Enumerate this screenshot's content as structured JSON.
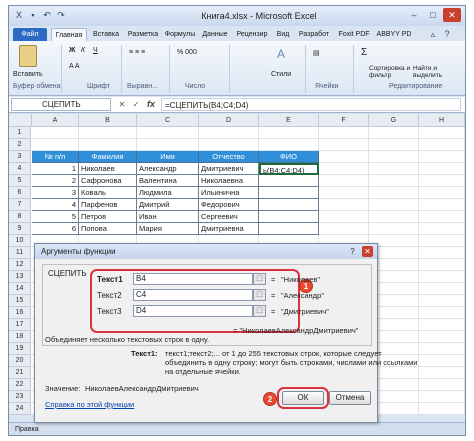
{
  "window": {
    "title": "Книга4.xlsx - Microsoft Excel"
  },
  "tabs": [
    "Файл",
    "Главная",
    "Вставка",
    "Разметка",
    "Формулы",
    "Данные",
    "Рецензир",
    "Вид",
    "Разработ",
    "Foxit PDF",
    "ABBYY PD"
  ],
  "ribbon": {
    "paste": "Вставить",
    "clipboard": "Буфер обмена",
    "font": "Шрифт",
    "align": "Выравн...",
    "number": "Число",
    "styles": "Стили",
    "cells": "Ячейки",
    "sort": "Сортировка и фильтр",
    "find": "Найти и выделить",
    "editing": "Редактирование"
  },
  "formula_bar": {
    "name_box": "СЦЕПИТЬ",
    "formula": "=СЦЕПИТЬ(B4;C4;D4)"
  },
  "sheet": {
    "columns": [
      "A",
      "B",
      "C",
      "D",
      "E"
    ],
    "rows": [
      "1",
      "2",
      "3",
      "4",
      "5",
      "6",
      "7",
      "8",
      "9",
      "10",
      "11",
      "12",
      "13",
      "14",
      "15",
      "16",
      "17",
      "18",
      "19",
      "20",
      "21",
      "22",
      "23",
      "24"
    ],
    "header": [
      "№ п/п",
      "Фамилия",
      "Имя",
      "Отчество",
      "ФИО"
    ],
    "data": [
      [
        "1",
        "Николаев",
        "Александр",
        "Дмитриевич",
        "ь(B4;C4;D4)"
      ],
      [
        "2",
        "Сафронова",
        "Валентина",
        "Николаевна",
        ""
      ],
      [
        "3",
        "Коваль",
        "Людмила",
        "Ильинична",
        ""
      ],
      [
        "4",
        "Парфенов",
        "Дмитрий",
        "Федорович",
        ""
      ],
      [
        "5",
        "Петров",
        "Иван",
        "Сергеевич",
        ""
      ],
      [
        "6",
        "Попова",
        "Мария",
        "Дмитриевна",
        ""
      ]
    ]
  },
  "dialog": {
    "title": "Аргументы функции",
    "function": "СЦЕПИТЬ",
    "args": [
      {
        "label": "Текст1",
        "value": "B4",
        "result": "\"Николаев\""
      },
      {
        "label": "Текст2",
        "value": "C4",
        "result": "\"Александр\""
      },
      {
        "label": "Текст3",
        "value": "D4",
        "result": "\"Дмитриевич\""
      }
    ],
    "eq": "=",
    "total_result": "= \"НиколаевАлександрДмитриевич\"",
    "description": "Объединяет несколько текстовых строк в одну.",
    "arg_label": "Текст1:",
    "arg_desc": [
      "текст1;текст2;... от 1 до 255 текстовых строк, которые следует",
      "объединить в одну строку; могут быть строками, числами или ссылками",
      "на отдельные ячейки."
    ],
    "value_label": "Значение:",
    "value": "НиколаевАлександрДмитриевич",
    "help": "Справка по этой функции",
    "ok": "ОК",
    "cancel": "Отмена",
    "badge1": "1",
    "badge2": "2"
  },
  "status": {
    "left": "Правка"
  },
  "colors": {
    "header": "#2f8fd9",
    "highlight": "#d9333f"
  }
}
